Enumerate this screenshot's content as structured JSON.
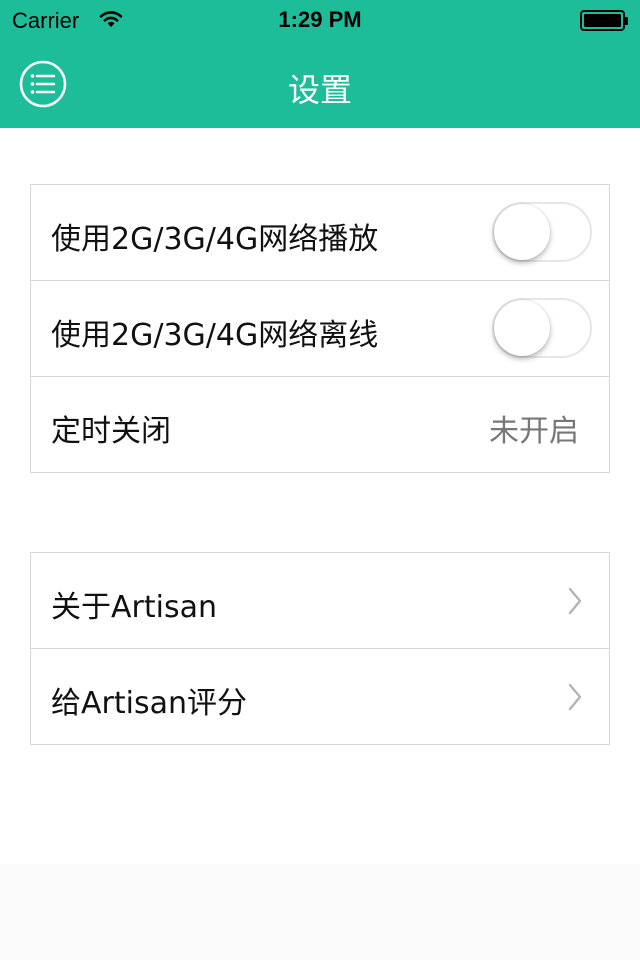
{
  "status_bar": {
    "carrier": "Carrier",
    "time": "1:29 PM"
  },
  "nav": {
    "title": "设置",
    "menu_icon": "list-menu-icon"
  },
  "colors": {
    "accent": "#1dbd9a"
  },
  "settings_group_1": [
    {
      "label": "使用2G/3G/4G网络播放",
      "control": "toggle",
      "on": false
    },
    {
      "label": "使用2G/3G/4G网络离线",
      "control": "toggle",
      "on": false
    },
    {
      "label": "定时关闭",
      "value": "未开启"
    }
  ],
  "settings_group_2": [
    {
      "label": "关于Artisan",
      "icon": "chevron-right-icon"
    },
    {
      "label": "给Artisan评分",
      "icon": "chevron-right-icon"
    }
  ]
}
